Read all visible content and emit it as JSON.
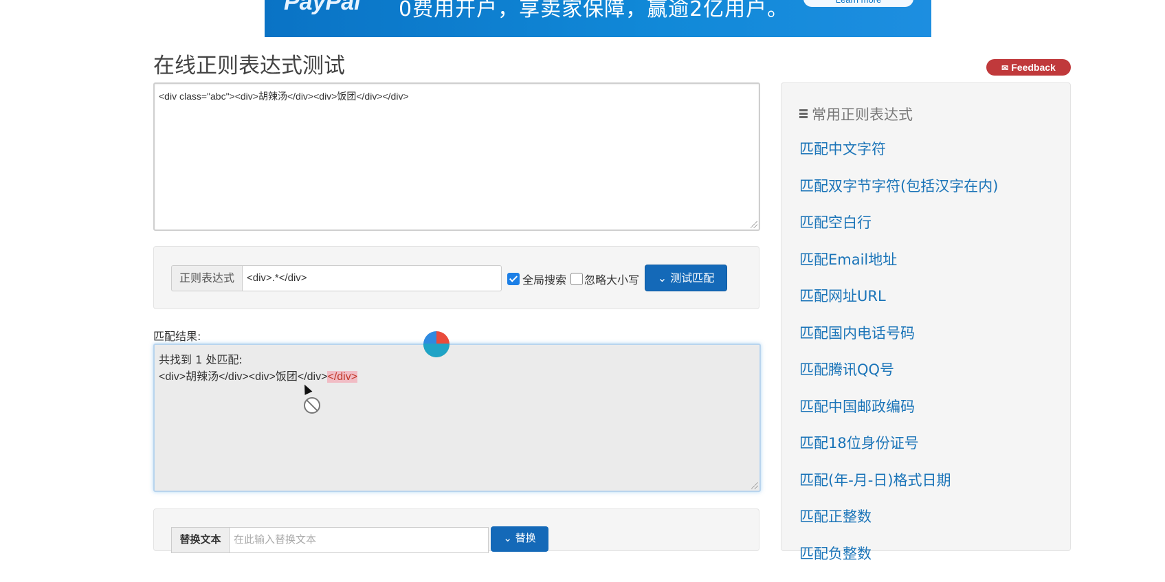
{
  "banner": {
    "brand": "PayPal",
    "text": "0费用开户，享卖家保障，赢逾2亿用户。",
    "cta": "Learn more"
  },
  "page": {
    "title": "在线正则表达式测试"
  },
  "feedback": {
    "label": "Feedback"
  },
  "source": {
    "text": "<div class=\"abc\"><div>胡辣汤</div><div>饭团</div></div>"
  },
  "regex": {
    "addon_label": "正则表达式",
    "value": "<div>.*</div>",
    "global_label": "全局搜索",
    "global_checked": true,
    "ignorecase_label": "忽略大小写",
    "ignorecase_checked": false,
    "test_button": "测试匹配"
  },
  "result": {
    "label": "匹配结果:",
    "count_text": "共找到 1 处匹配:",
    "match_plain": "<div>胡辣汤</div><div>饭团</div>",
    "match_highlight": "</div>"
  },
  "replace": {
    "addon_label": "替换文本",
    "placeholder": "在此输入替换文本",
    "button": "替换"
  },
  "sidebar": {
    "title": "常用正则表达式",
    "items": [
      {
        "label": "匹配中文字符"
      },
      {
        "label": "匹配双字节字符(包括汉字在内)"
      },
      {
        "label": "匹配空白行"
      },
      {
        "label": "匹配Email地址"
      },
      {
        "label": "匹配网址URL"
      },
      {
        "label": "匹配国内电话号码"
      },
      {
        "label": "匹配腾讯QQ号"
      },
      {
        "label": "匹配中国邮政编码"
      },
      {
        "label": "匹配18位身份证号"
      },
      {
        "label": "匹配(年-月-日)格式日期"
      },
      {
        "label": "匹配正整数"
      },
      {
        "label": "匹配负整数"
      }
    ]
  },
  "colors": {
    "banner": "#1189d8",
    "feedback": "#c0393b",
    "button": "#1469b8",
    "link": "#1a74b8",
    "highlight": "#f1bcc4"
  },
  "icons": [
    "envelope-icon",
    "chevron-down-icon",
    "list-icon",
    "loading-spinner-icon",
    "mouse-cursor-icon",
    "not-allowed-icon"
  ]
}
